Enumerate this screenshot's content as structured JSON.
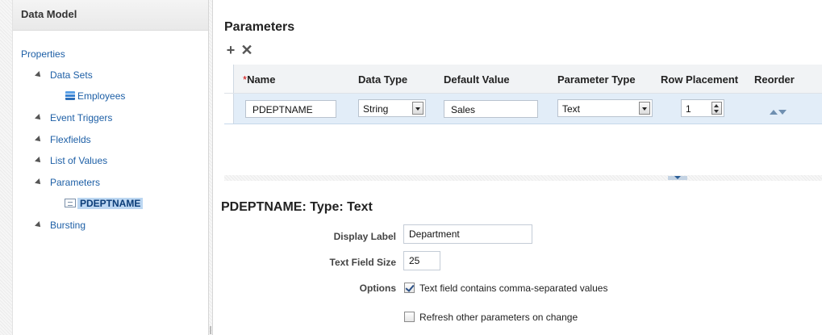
{
  "sidebar": {
    "title": "Data Model",
    "properties": "Properties",
    "data_sets": "Data Sets",
    "employees": "Employees",
    "event_triggers": "Event Triggers",
    "flexfields": "Flexfields",
    "list_of_values": "List of Values",
    "parameters": "Parameters",
    "selected_param": "PDEPTNAME",
    "bursting": "Bursting"
  },
  "main": {
    "title": "Parameters",
    "toolbar": {
      "add_icon": "plus-icon",
      "delete_icon": "close-icon"
    },
    "columns": {
      "name_req": "*",
      "name": "Name",
      "data_type": "Data Type",
      "default_value": "Default Value",
      "parameter_type": "Parameter Type",
      "row_placement": "Row Placement",
      "reorder": "Reorder"
    },
    "row": {
      "name": "PDEPTNAME",
      "data_type": "String",
      "default_value": "Sales",
      "parameter_type": "Text",
      "row_placement": "1"
    }
  },
  "detail": {
    "title": "PDEPTNAME: Type: Text",
    "display_label_label": "Display Label",
    "display_label_value": "Department",
    "text_field_size_label": "Text Field Size",
    "text_field_size_value": "25",
    "options_label": "Options",
    "option1": "Text field contains comma-separated values",
    "option1_checked": true,
    "option2": "Refresh other parameters on change",
    "option2_checked": false
  }
}
